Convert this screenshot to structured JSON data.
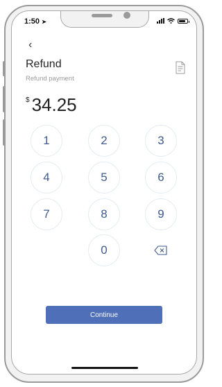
{
  "status": {
    "time": "1:50"
  },
  "header": {
    "back_icon": "chevron-left-icon",
    "title": "Refund",
    "subtitle": "Refund payment",
    "receipt_icon": "receipt-icon"
  },
  "amount": {
    "currency": "$",
    "value": "34.25"
  },
  "keypad": {
    "keys": [
      "1",
      "2",
      "3",
      "4",
      "5",
      "6",
      "7",
      "8",
      "9",
      "0"
    ],
    "delete_icon": "backspace-icon"
  },
  "actions": {
    "continue_label": "Continue",
    "accent": "#4f6fb8"
  }
}
